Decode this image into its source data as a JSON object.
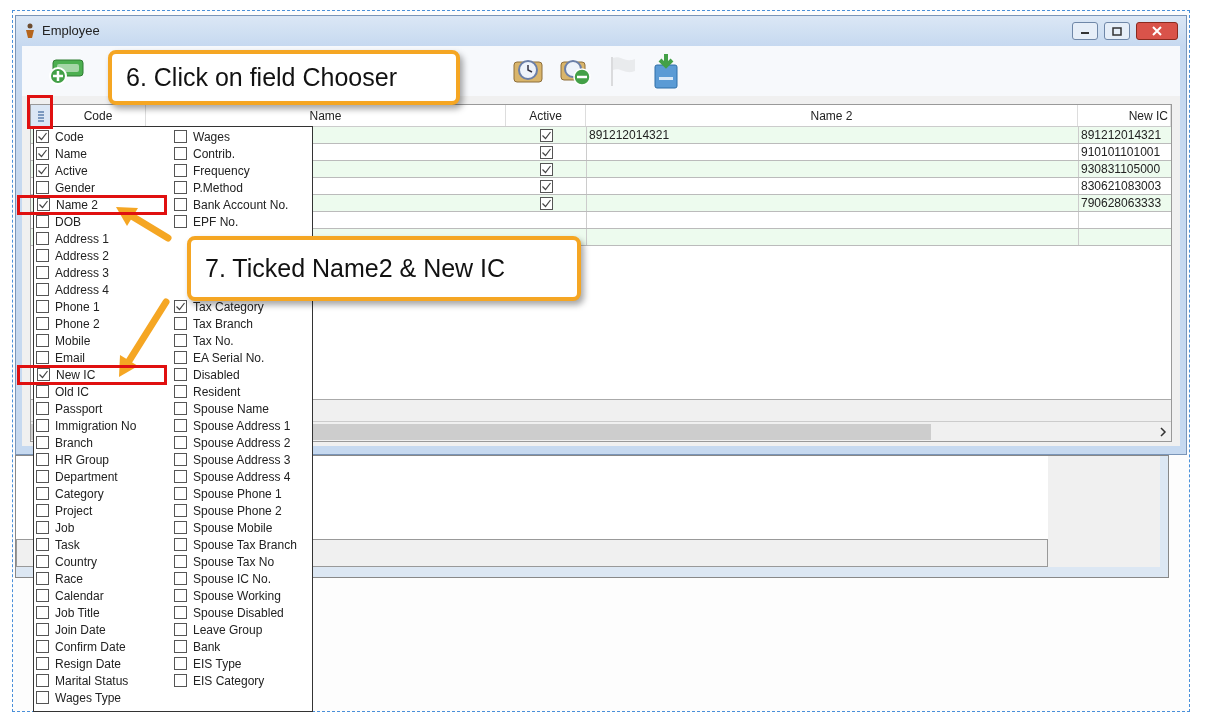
{
  "window": {
    "title": "Employee"
  },
  "toolbar": {
    "buttons": [
      {
        "kind": "money-add",
        "disabled": false
      },
      {
        "kind": "clock",
        "disabled": false
      },
      {
        "kind": "clock-remove",
        "disabled": false
      },
      {
        "kind": "flag",
        "disabled": true
      },
      {
        "kind": "cabinet",
        "disabled": false
      }
    ]
  },
  "grid": {
    "columns": [
      {
        "label": "Code"
      },
      {
        "label": "Name"
      },
      {
        "label": "Active"
      },
      {
        "label": "Name 2"
      },
      {
        "label": "New IC"
      }
    ],
    "rows": [
      {
        "active": true,
        "name_2": "891212014321",
        "new_ic": "891212014321"
      },
      {
        "active": true,
        "new_ic": "910101101001"
      },
      {
        "active": true,
        "new_ic": "930831105000"
      },
      {
        "active": true,
        "new_ic": "830621083003"
      },
      {
        "active": true,
        "new_ic": "790628063333"
      }
    ]
  },
  "field_chooser": {
    "column_1": [
      {
        "label": "Code",
        "checked": true,
        "highlighted": false
      },
      {
        "label": "Name",
        "checked": true,
        "highlighted": false
      },
      {
        "label": "Active",
        "checked": true,
        "highlighted": false
      },
      {
        "label": "Gender",
        "checked": false,
        "highlighted": false
      },
      {
        "label": "Name 2",
        "checked": true,
        "highlighted": true
      },
      {
        "label": "DOB",
        "checked": false,
        "highlighted": false
      },
      {
        "label": "Address 1",
        "checked": false,
        "highlighted": false
      },
      {
        "label": "Address 2",
        "checked": false,
        "highlighted": false
      },
      {
        "label": "Address 3",
        "checked": false,
        "highlighted": false
      },
      {
        "label": "Address 4",
        "checked": false,
        "highlighted": false
      },
      {
        "label": "Phone 1",
        "checked": false,
        "highlighted": false
      },
      {
        "label": "Phone 2",
        "checked": false,
        "highlighted": false
      },
      {
        "label": "Mobile",
        "checked": false,
        "highlighted": false
      },
      {
        "label": "Email",
        "checked": false,
        "highlighted": false
      },
      {
        "label": "New IC",
        "checked": true,
        "highlighted": true
      },
      {
        "label": "Old IC",
        "checked": false,
        "highlighted": false
      },
      {
        "label": "Passport",
        "checked": false,
        "highlighted": false
      },
      {
        "label": "Immigration No",
        "checked": false,
        "highlighted": false
      },
      {
        "label": "Branch",
        "checked": false,
        "highlighted": false
      },
      {
        "label": "HR Group",
        "checked": false,
        "highlighted": false
      },
      {
        "label": "Department",
        "checked": false,
        "highlighted": false
      },
      {
        "label": "Category",
        "checked": false,
        "highlighted": false
      },
      {
        "label": "Project",
        "checked": false,
        "highlighted": false
      },
      {
        "label": "Job",
        "checked": false,
        "highlighted": false
      },
      {
        "label": "Task",
        "checked": false,
        "highlighted": false
      },
      {
        "label": "Country",
        "checked": false,
        "highlighted": false
      },
      {
        "label": "Race",
        "checked": false,
        "highlighted": false
      },
      {
        "label": "Calendar",
        "checked": false,
        "highlighted": false
      },
      {
        "label": "Job Title",
        "checked": false,
        "highlighted": false
      },
      {
        "label": "Join Date",
        "checked": false,
        "highlighted": false
      },
      {
        "label": "Confirm Date",
        "checked": false,
        "highlighted": false
      },
      {
        "label": "Resign Date",
        "checked": false,
        "highlighted": false
      },
      {
        "label": "Marital Status",
        "checked": false,
        "highlighted": false
      },
      {
        "label": "Wages Type",
        "checked": false,
        "highlighted": false
      }
    ],
    "column_2_top": [
      {
        "label": "Wages",
        "checked": false
      },
      {
        "label": "Contrib.",
        "checked": false
      },
      {
        "label": "Frequency",
        "checked": false
      },
      {
        "label": "P.Method",
        "checked": false
      },
      {
        "label": "Bank Account No.",
        "checked": false
      },
      {
        "label": "EPF No.",
        "checked": false
      }
    ],
    "column_2_bottom": [
      {
        "label": "Tax Category",
        "checked": true
      },
      {
        "label": "Tax Branch",
        "checked": false
      },
      {
        "label": "Tax No.",
        "checked": false
      },
      {
        "label": "EA Serial No.",
        "checked": false
      },
      {
        "label": "Disabled",
        "checked": false
      },
      {
        "label": "Resident",
        "checked": false
      },
      {
        "label": "Spouse Name",
        "checked": false
      },
      {
        "label": "Spouse Address 1",
        "checked": false
      },
      {
        "label": "Spouse Address 2",
        "checked": false
      },
      {
        "label": "Spouse Address 3",
        "checked": false
      },
      {
        "label": "Spouse Address 4",
        "checked": false
      },
      {
        "label": "Spouse Phone 1",
        "checked": false
      },
      {
        "label": "Spouse Phone 2",
        "checked": false
      },
      {
        "label": "Spouse Mobile",
        "checked": false
      },
      {
        "label": "Spouse Tax Branch",
        "checked": false
      },
      {
        "label": "Spouse Tax No",
        "checked": false
      },
      {
        "label": "Spouse IC No.",
        "checked": false
      },
      {
        "label": "Spouse Working",
        "checked": false
      },
      {
        "label": "Spouse Disabled",
        "checked": false
      },
      {
        "label": "Leave Group",
        "checked": false
      },
      {
        "label": "Bank",
        "checked": false
      },
      {
        "label": "EIS Type",
        "checked": false
      },
      {
        "label": "EIS Category",
        "checked": false
      }
    ]
  },
  "callouts": [
    {
      "text": "6. Click on field Chooser"
    },
    {
      "text": "7. Ticked Name2 & New IC"
    }
  ]
}
